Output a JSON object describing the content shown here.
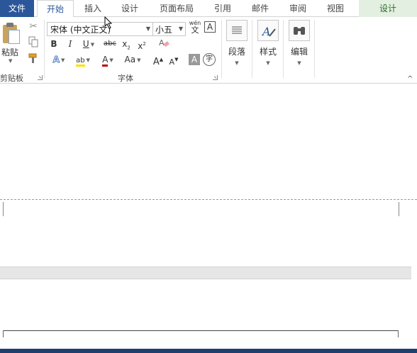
{
  "tabs": {
    "file": "文件",
    "home": "开始",
    "insert": "插入",
    "design": "设计",
    "layout": "页面布局",
    "references": "引用",
    "mailings": "邮件",
    "review": "审阅",
    "view": "视图",
    "ctx_design": "设计"
  },
  "clipboard": {
    "paste": "粘贴",
    "group_label": "剪贴板"
  },
  "font": {
    "name": "宋体 (中文正文)",
    "size": "小五",
    "phonetic_top": "wén",
    "phonetic_bottom": "文",
    "char_border": "A",
    "bold": "B",
    "italic": "I",
    "underline": "U",
    "strike": "abc",
    "subscript": "x",
    "subscript_mark": "2",
    "superscript": "x",
    "superscript_mark": "2",
    "text_effects": "A",
    "highlight": "ab",
    "font_color": "A",
    "change_case": "Aa",
    "grow": "A",
    "shrink": "A",
    "char_shading": "A",
    "enclose": "字",
    "group_label": "字体"
  },
  "paragraph": {
    "label": "段落"
  },
  "styles": {
    "label": "样式"
  },
  "editing": {
    "label": "编辑"
  },
  "colors": {
    "file_tab": "#2b579a",
    "highlight": "#ffe000",
    "font_color": "#c00000",
    "context_tab": "#e3efe0"
  }
}
